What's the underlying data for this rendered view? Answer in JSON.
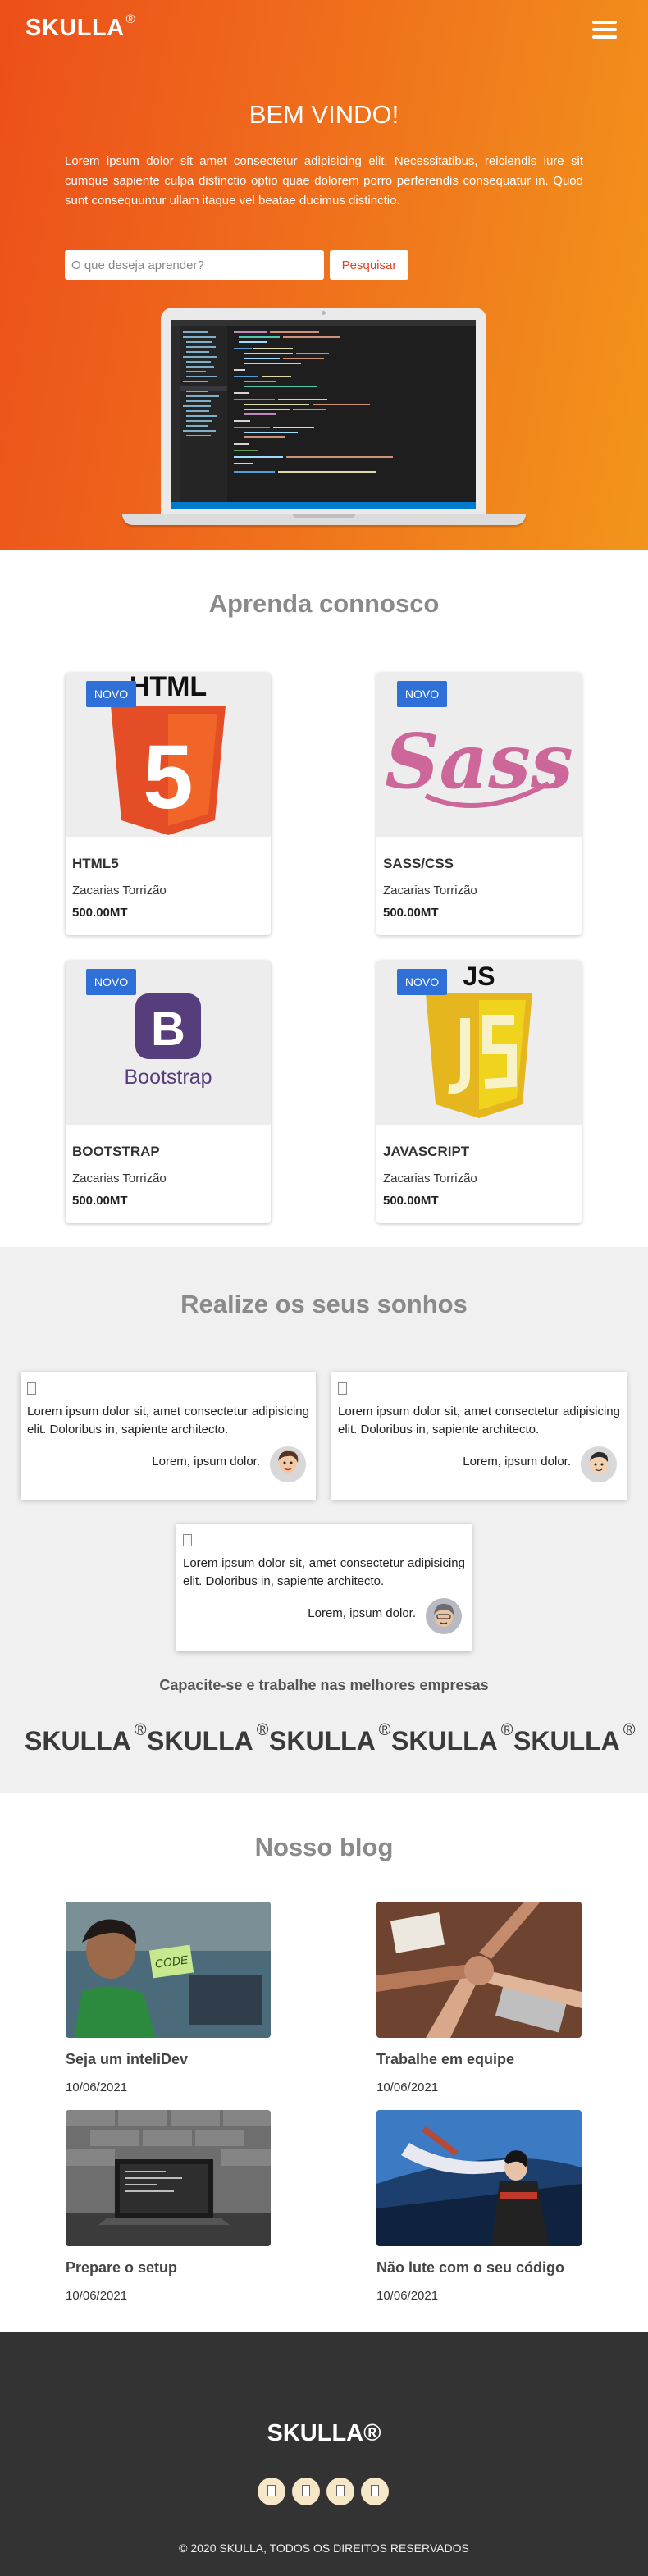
{
  "header": {
    "brand": "SKULLA",
    "brand_mark": "®",
    "menu_icon": "hamburger-menu-icon"
  },
  "hero": {
    "title": "BEM VINDO!",
    "text": "Lorem ipsum dolor sit amet consectetur adipisicing elit. Necessitatibus, reiciendis iure sit cumque sapiente culpa distinctio optio quae dolorem porro perferendis consequatur in. Quod sunt consequuntur ullam itaque vel beatae ducimus distinctio.",
    "search_placeholder": "O que deseja aprender?",
    "search_button": "Pesquisar"
  },
  "courses": {
    "title": "Aprenda connosco",
    "items": [
      {
        "badge": "NOVO",
        "name": "HTML5",
        "author": "Zacarias Torrizão",
        "price": "500.00MT",
        "logo_text": "HTML",
        "logo_glyph": "5"
      },
      {
        "badge": "NOVO",
        "name": "SASS/CSS",
        "author": "Zacarias Torrizão",
        "price": "500.00MT",
        "logo_text": "Sass"
      },
      {
        "badge": "NOVO",
        "name": "BOOTSTRAP",
        "author": "Zacarias Torrizão",
        "price": "500.00MT",
        "logo_glyph": "B",
        "logo_text": "Bootstrap"
      },
      {
        "badge": "NOVO",
        "name": "JAVASCRIPT",
        "author": "Zacarias Torrizão",
        "price": "500.00MT",
        "logo_text": "JS"
      }
    ]
  },
  "dreams": {
    "title": "Realize os seus sonhos",
    "testimonials": [
      {
        "text": "Lorem ipsum dolor sit, amet consectetur adipisicing elit. Doloribus in, sapiente architecto.",
        "author": "Lorem, ipsum dolor."
      },
      {
        "text": "Lorem ipsum dolor sit, amet consectetur adipisicing elit. Doloribus in, sapiente architecto.",
        "author": "Lorem, ipsum dolor."
      },
      {
        "text": "Lorem ipsum dolor sit, amet consectetur adipisicing elit. Doloribus in, sapiente architecto.",
        "author": "Lorem, ipsum dolor."
      }
    ],
    "companies_title": "Capacite-se e trabalhe nas melhores empresas",
    "company_logos": [
      "SKULLA",
      "SKULLA",
      "SKULLA",
      "SKULLA",
      "SKULLA"
    ],
    "logo_mark": "®"
  },
  "blog": {
    "title": "Nosso blog",
    "posts": [
      {
        "title": "Seja um inteliDev",
        "date": "10/06/2021",
        "sticker": "CODE"
      },
      {
        "title": "Trabalhe em equipe",
        "date": "10/06/2021"
      },
      {
        "title": "Prepare o setup",
        "date": "10/06/2021"
      },
      {
        "title": "Não lute com o seu código",
        "date": "10/06/2021"
      }
    ]
  },
  "footer": {
    "brand": "SKULLA®",
    "social_icons": [
      "facebook-icon",
      "instagram-icon",
      "twitter-icon",
      "linkedin-icon"
    ],
    "copyright": "© 2020 SKULLA, TODOS OS DIREITOS RESERVADOS"
  },
  "colors": {
    "hero_start": "#ec4f1a",
    "hero_end": "#f2951b",
    "badge": "#2f6fd8",
    "search_button_text": "#e0442b",
    "footer_bg": "#333333"
  }
}
